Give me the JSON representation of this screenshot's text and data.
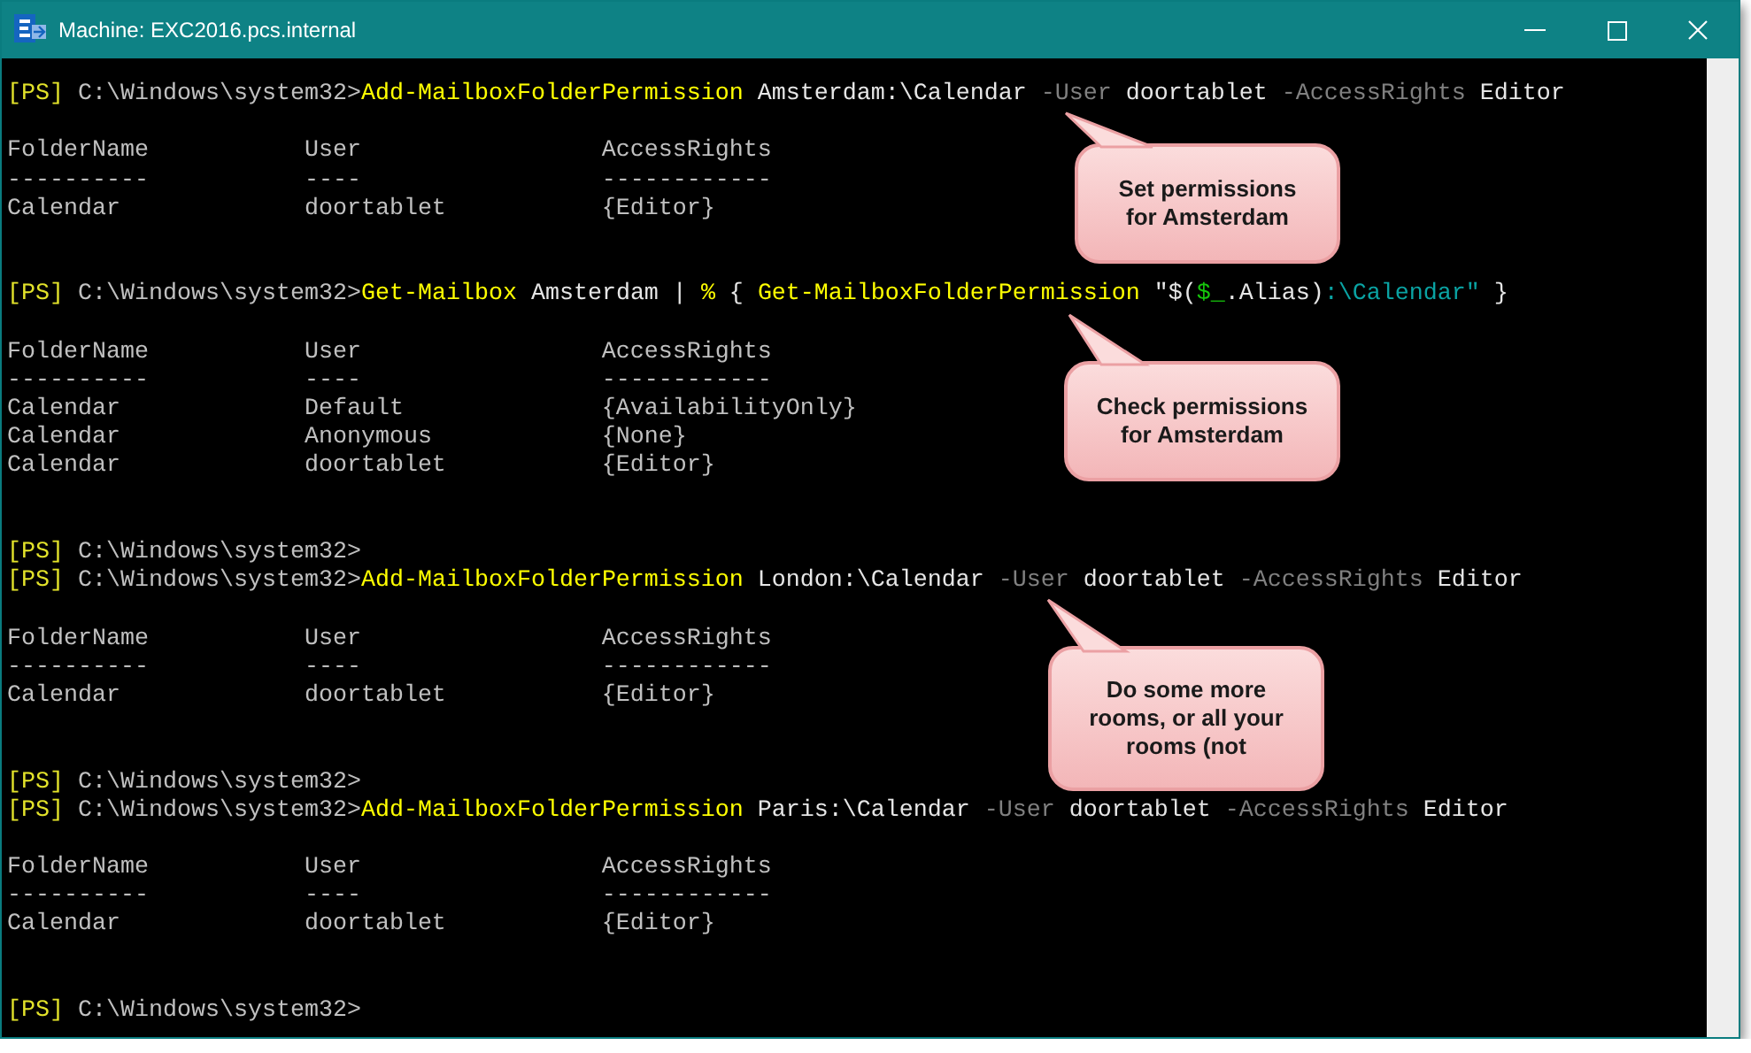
{
  "window": {
    "title": "Machine: EXC2016.pcs.internal"
  },
  "entries": [
    {
      "prompt": "[PS]",
      "path": "C:\\Windows\\system32>",
      "command": [
        {
          "kind": "cmdlet",
          "text": "Add-MailboxFolderPermission"
        },
        {
          "kind": "arg",
          "text": " Amsterdam:\\Calendar "
        },
        {
          "kind": "param",
          "text": "-User"
        },
        {
          "kind": "arg",
          "text": " doortablet "
        },
        {
          "kind": "param",
          "text": "-AccessRights"
        },
        {
          "kind": "arg",
          "text": " Editor"
        }
      ],
      "table": {
        "columns": [
          {
            "title": "FolderName",
            "underline": "----------"
          },
          {
            "title": "User",
            "underline": "----"
          },
          {
            "title": "AccessRights",
            "underline": "------------"
          }
        ],
        "rows": [
          [
            "Calendar",
            "doortablet",
            "{Editor}"
          ]
        ]
      }
    },
    {
      "prompt": "[PS]",
      "path": "C:\\Windows\\system32>",
      "command": [
        {
          "kind": "cmdlet",
          "text": "Get-Mailbox"
        },
        {
          "kind": "arg",
          "text": " Amsterdam | "
        },
        {
          "kind": "cmdlet",
          "text": "%"
        },
        {
          "kind": "arg",
          "text": " { "
        },
        {
          "kind": "cmdlet",
          "text": "Get-MailboxFolderPermission"
        },
        {
          "kind": "arg",
          "text": " \"$("
        },
        {
          "kind": "variable",
          "text": "$_"
        },
        {
          "kind": "arg",
          "text": ".Alias)"
        },
        {
          "kind": "string",
          "text": ":\\Calendar\""
        },
        {
          "kind": "arg",
          "text": " }"
        }
      ],
      "table": {
        "columns": [
          {
            "title": "FolderName",
            "underline": "----------"
          },
          {
            "title": "User",
            "underline": "----"
          },
          {
            "title": "AccessRights",
            "underline": "------------"
          }
        ],
        "rows": [
          [
            "Calendar",
            "Default",
            "{AvailabilityOnly}"
          ],
          [
            "Calendar",
            "Anonymous",
            "{None}"
          ],
          [
            "Calendar",
            "doortablet",
            "{Editor}"
          ]
        ]
      }
    },
    {
      "prompt": "[PS]",
      "path": "C:\\Windows\\system32>"
    },
    {
      "prompt": "[PS]",
      "path": "C:\\Windows\\system32>",
      "command": [
        {
          "kind": "cmdlet",
          "text": "Add-MailboxFolderPermission"
        },
        {
          "kind": "arg",
          "text": " London:\\Calendar "
        },
        {
          "kind": "param",
          "text": "-User"
        },
        {
          "kind": "arg",
          "text": " doortablet "
        },
        {
          "kind": "param",
          "text": "-AccessRights"
        },
        {
          "kind": "arg",
          "text": " Editor"
        }
      ],
      "table": {
        "columns": [
          {
            "title": "FolderName",
            "underline": "----------"
          },
          {
            "title": "User",
            "underline": "----"
          },
          {
            "title": "AccessRights",
            "underline": "------------"
          }
        ],
        "rows": [
          [
            "Calendar",
            "doortablet",
            "{Editor}"
          ]
        ]
      }
    },
    {
      "prompt": "[PS]",
      "path": "C:\\Windows\\system32>"
    },
    {
      "prompt": "[PS]",
      "path": "C:\\Windows\\system32>",
      "command": [
        {
          "kind": "cmdlet",
          "text": "Add-MailboxFolderPermission"
        },
        {
          "kind": "arg",
          "text": " Paris:\\Calendar "
        },
        {
          "kind": "param",
          "text": "-User"
        },
        {
          "kind": "arg",
          "text": " doortablet "
        },
        {
          "kind": "param",
          "text": "-AccessRights"
        },
        {
          "kind": "arg",
          "text": " Editor"
        }
      ],
      "table": {
        "columns": [
          {
            "title": "FolderName",
            "underline": "----------"
          },
          {
            "title": "User",
            "underline": "----"
          },
          {
            "title": "AccessRights",
            "underline": "------------"
          }
        ],
        "rows": [
          [
            "Calendar",
            "doortablet",
            "{Editor}"
          ]
        ]
      }
    },
    {
      "prompt": "[PS]",
      "path": "C:\\Windows\\system32>"
    }
  ],
  "callouts": [
    {
      "lines": [
        "Set permissions",
        "for Amsterdam"
      ]
    },
    {
      "lines": [
        "Check permissions",
        "for Amsterdam"
      ]
    },
    {
      "lines": [
        "Do some more",
        "rooms, or all your",
        "rooms (not"
      ]
    }
  ]
}
